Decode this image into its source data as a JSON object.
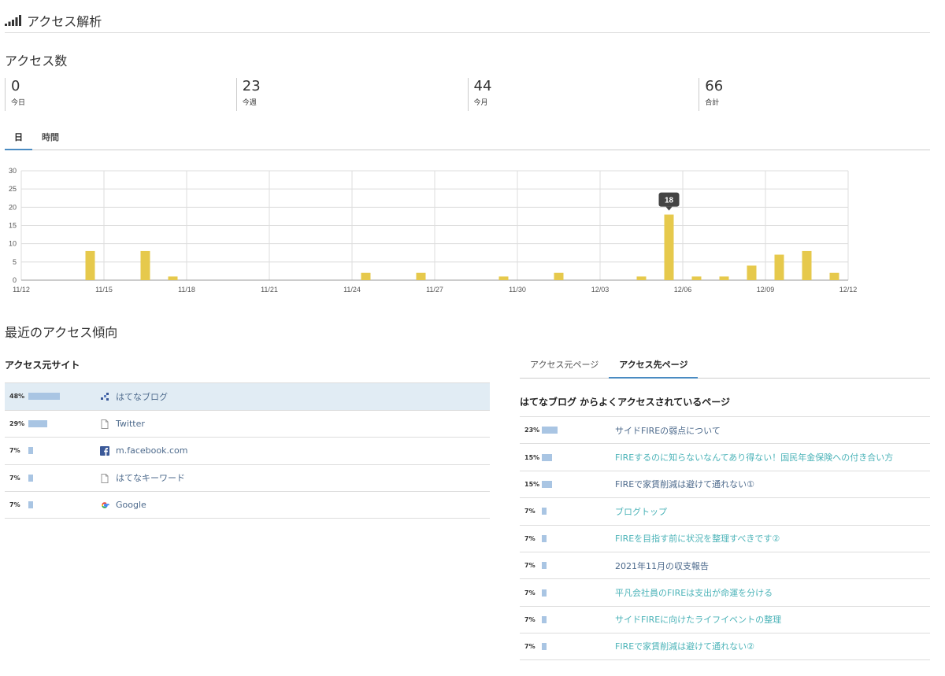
{
  "header": {
    "title": "アクセス解析"
  },
  "access_count": {
    "title": "アクセス数",
    "stats": [
      {
        "value": "0",
        "label": "今日"
      },
      {
        "value": "23",
        "label": "今週"
      },
      {
        "value": "44",
        "label": "今月"
      },
      {
        "value": "66",
        "label": "合計"
      }
    ]
  },
  "tabs": [
    {
      "label": "日"
    },
    {
      "label": "時間"
    }
  ],
  "chart_data": {
    "type": "bar",
    "ylim": [
      0,
      30
    ],
    "yticks": [
      "0",
      "5",
      "10",
      "15",
      "20",
      "25",
      "30"
    ],
    "xtick_labels": [
      "11/12",
      "11/15",
      "11/18",
      "11/21",
      "11/24",
      "11/27",
      "11/30",
      "12/03",
      "12/06",
      "12/09",
      "12/12"
    ],
    "x": [
      "11/12",
      "11/13",
      "11/14",
      "11/15",
      "11/16",
      "11/17",
      "11/18",
      "11/19",
      "11/20",
      "11/21",
      "11/22",
      "11/23",
      "11/24",
      "11/25",
      "11/26",
      "11/27",
      "11/28",
      "11/29",
      "11/30",
      "12/01",
      "12/02",
      "12/03",
      "12/04",
      "12/05",
      "12/06",
      "12/07",
      "12/08",
      "12/09",
      "12/10",
      "12/11"
    ],
    "values": [
      0,
      0,
      8,
      0,
      8,
      1,
      0,
      0,
      0,
      0,
      0,
      0,
      2,
      0,
      2,
      0,
      0,
      1,
      0,
      2,
      0,
      0,
      1,
      18,
      1,
      1,
      4,
      7,
      8,
      2
    ],
    "bar_color": "#e6c94c",
    "grid": true,
    "tooltip": "18"
  },
  "trends": {
    "title": "最近のアクセス傾向"
  },
  "sources": {
    "title": "アクセス元サイト",
    "items": [
      {
        "pct": "48%",
        "share": 48,
        "label": "はてなブログ",
        "icon": "hatena-blog-icon"
      },
      {
        "pct": "29%",
        "share": 29,
        "label": "Twitter",
        "icon": "document-icon"
      },
      {
        "pct": "7%",
        "share": 7,
        "label": "m.facebook.com",
        "icon": "facebook-icon"
      },
      {
        "pct": "7%",
        "share": 7,
        "label": "はてなキーワード",
        "icon": "document-icon"
      },
      {
        "pct": "7%",
        "share": 7,
        "label": "Google",
        "icon": "google-icon"
      }
    ]
  },
  "pages": {
    "tabs": [
      {
        "label": "アクセス元ページ"
      },
      {
        "label": "アクセス先ページ"
      }
    ],
    "heading": "はてなブログ からよくアクセスされているページ",
    "items": [
      {
        "pct": "23%",
        "share": 23,
        "label": "サイドFIREの弱点について"
      },
      {
        "pct": "15%",
        "share": 15,
        "label": "FIREするのに知らないなんてあり得ない！国民年金保険への付き合い方"
      },
      {
        "pct": "15%",
        "share": 15,
        "label": "FIREで家賃削減は避けて通れない①"
      },
      {
        "pct": "7%",
        "share": 7,
        "label": "ブログトップ"
      },
      {
        "pct": "7%",
        "share": 7,
        "label": "FIREを目指す前に状況を整理すべきです②"
      },
      {
        "pct": "7%",
        "share": 7,
        "label": "2021年11月の収支報告"
      },
      {
        "pct": "7%",
        "share": 7,
        "label": "平凡会社員のFIREは支出が命運を分ける"
      },
      {
        "pct": "7%",
        "share": 7,
        "label": "サイドFIREに向けたライフイベントの整理"
      },
      {
        "pct": "7%",
        "share": 7,
        "label": "FIREで家賃削減は避けて通れない②"
      }
    ]
  },
  "colors": {
    "accent": "#4a8bc2",
    "bar": "#e6c94c",
    "share_bar": "#a9c5e3",
    "highlight": "#e1ecf4",
    "link_dark": "#4d6a8c",
    "link_teal": "#4bb3b8"
  }
}
